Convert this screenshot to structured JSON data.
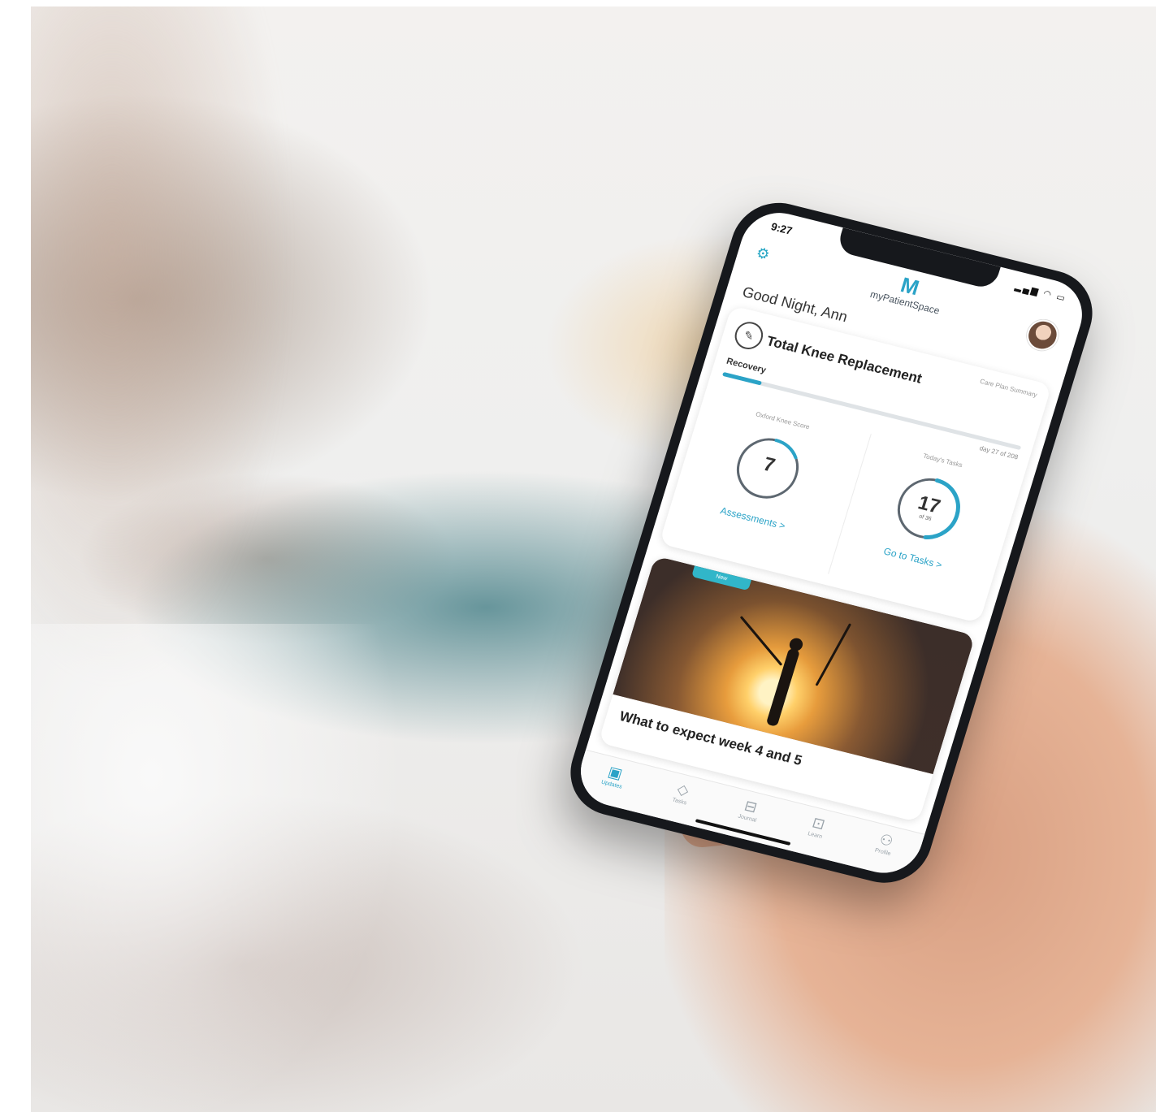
{
  "status": {
    "time": "9:27"
  },
  "header": {
    "logo_text": "myPatientSpace",
    "greeting": "Good Night, Ann"
  },
  "care_plan": {
    "summary_label": "Care Plan Summary",
    "title": "Total Knee Replacement",
    "phase": "Recovery",
    "day": "day 27 of 208",
    "progress_fraction": 0.13
  },
  "stats": {
    "knee_score": {
      "label": "Oxford Knee Score",
      "value": "7",
      "link": "Assessments >",
      "fraction": 0.15
    },
    "tasks": {
      "label": "Today's Tasks",
      "value": "17",
      "sub": "of 36",
      "link": "Go to Tasks >",
      "fraction": 0.47
    }
  },
  "content_card": {
    "badge": "New",
    "title": "What to expect week 4 and 5"
  },
  "tabs": [
    {
      "label": "Updates",
      "icon": "updates-icon",
      "active": true
    },
    {
      "label": "Tasks",
      "icon": "tasks-icon",
      "active": false
    },
    {
      "label": "Journal",
      "icon": "journal-icon",
      "active": false
    },
    {
      "label": "Learn",
      "icon": "learn-icon",
      "active": false
    },
    {
      "label": "Profile",
      "icon": "profile-icon",
      "active": false
    }
  ],
  "colors": {
    "accent": "#2ba3c7",
    "badge": "#31b6c9",
    "phone_frame": "#16181c"
  }
}
